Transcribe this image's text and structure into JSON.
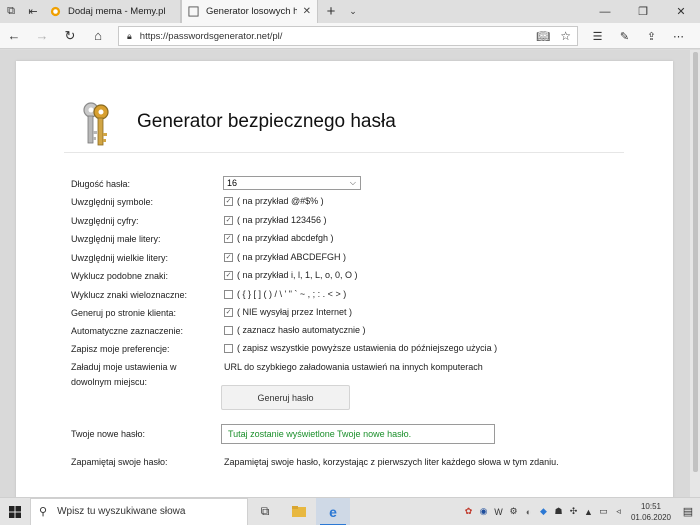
{
  "browser": {
    "tabs": [
      {
        "label": "Dodaj mema - Memy.pl",
        "active": false
      },
      {
        "label": "Generator losowych has",
        "active": true
      }
    ],
    "url": "https://passwordsgenerator.net/pl/"
  },
  "page": {
    "title": "Generator bezpiecznego hasła",
    "length": {
      "label": "Długość hasła:",
      "value": "16"
    },
    "options": [
      {
        "label": "Uwzględnij symbole:",
        "checked": true,
        "text": "( na przykład @#$% )"
      },
      {
        "label": "Uwzględnij cyfry:",
        "checked": true,
        "text": "( na przykład 123456 )"
      },
      {
        "label": "Uwzględnij małe litery:",
        "checked": true,
        "text": "( na przykład abcdefgh )"
      },
      {
        "label": "Uwzględnij wielkie litery:",
        "checked": true,
        "text": "( na przykład ABCDEFGH )"
      },
      {
        "label": "Wyklucz podobne znaki:",
        "checked": true,
        "text": "( na przykład i, l, 1, L, o, 0, O )"
      },
      {
        "label": "Wyklucz znaki wieloznaczne:",
        "checked": false,
        "text": "( { } [ ] ( ) / \\ ' \" ` ~ , ; : . < > )"
      },
      {
        "label": "Generuj po stronie klienta:",
        "checked": true,
        "text": "( NIE wysyłaj przez Internet )"
      },
      {
        "label": "Automatyczne zaznaczenie:",
        "checked": false,
        "text": "( zaznacz hasło automatycznie )"
      },
      {
        "label": "Zapisz moje preferencje:",
        "checked": false,
        "text": "( zapisz wszystkie powyższe ustawienia do późniejszego użycia )"
      }
    ],
    "load_settings": {
      "label_line1": "Załaduj moje ustawienia w",
      "label_line2": "dowolnym miejscu:",
      "text": "URL do szybkiego załadowania ustawień na innych komputerach"
    },
    "generate_button": "Generuj hasło",
    "new_password": {
      "label": "Twoje nowe hasło:",
      "value": "Tutaj zostanie wyświetlone Twoje nowe hasło."
    },
    "remember": {
      "label": "Zapamiętaj swoje hasło:",
      "text": "Zapamiętaj swoje hasło, korzystając z pierwszych liter każdego słowa w tym zdaniu."
    }
  },
  "taskbar": {
    "search_placeholder": "Wpisz tu wyszukiwane słowa",
    "time": "10:51",
    "date": "01.06.2020"
  },
  "colors": {
    "password_text": "#1a8f2a",
    "taskbar_accent": "#2b78d4"
  }
}
